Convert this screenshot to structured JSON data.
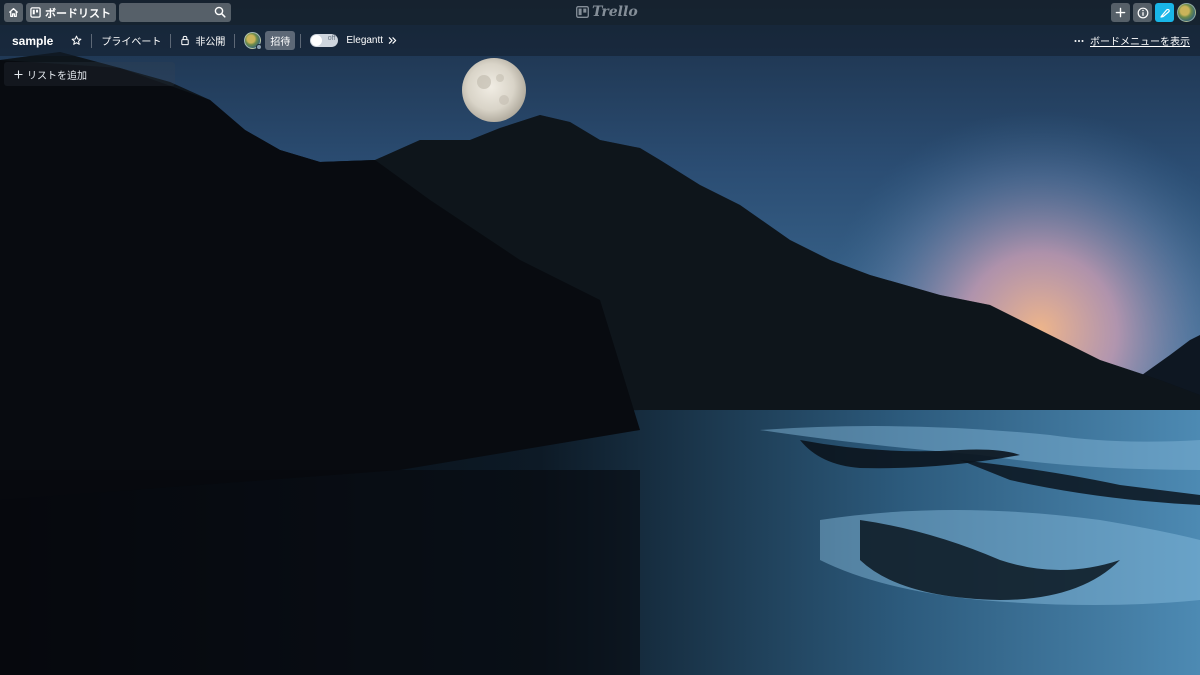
{
  "header": {
    "boards_label": "ボードリスト",
    "search_value": "",
    "logo_text": "Trello"
  },
  "board": {
    "title": "sample",
    "visibility_private": "プライベート",
    "visibility_closed": "非公開",
    "invite_label": "招待",
    "elegantt_toggle": "off",
    "elegantt_label": "Elegantt",
    "menu_label": "ボードメニューを表示"
  },
  "lists": {
    "add_list_label": "リストを追加"
  },
  "colors": {
    "accent_blue": "#19b6e8"
  }
}
